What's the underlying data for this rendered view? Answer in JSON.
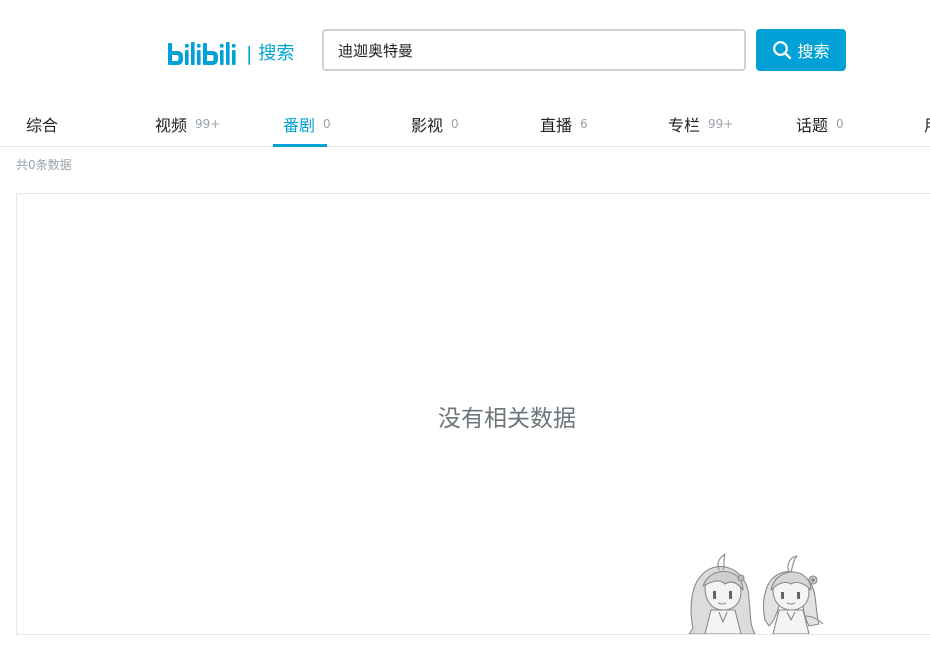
{
  "header": {
    "logo_brand": "bilibili",
    "logo_text": "搜索",
    "logo_separator": "|"
  },
  "search": {
    "value": "迪迦奥特曼",
    "button_label": "搜索"
  },
  "tabs": [
    {
      "label": "综合",
      "count": ""
    },
    {
      "label": "视频",
      "count": "99+"
    },
    {
      "label": "番剧",
      "count": "0",
      "active": true
    },
    {
      "label": "影视",
      "count": "0"
    },
    {
      "label": "直播",
      "count": "6"
    },
    {
      "label": "专栏",
      "count": "99+"
    },
    {
      "label": "话题",
      "count": "0"
    },
    {
      "label": "用",
      "count": ""
    }
  ],
  "result_summary": "共0条数据",
  "empty_state": {
    "message": "没有相关数据"
  },
  "colors": {
    "accent": "#00a1d6",
    "muted": "#99a2aa",
    "border": "#e5e9ef"
  }
}
